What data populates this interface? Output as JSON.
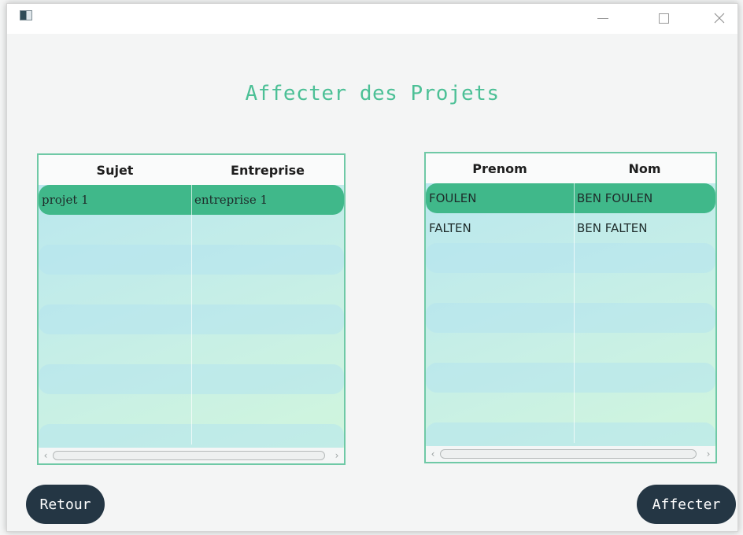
{
  "window": {
    "title": "",
    "controls": {
      "minimize": "minimize-icon",
      "maximize": "maximize-icon",
      "close": "close-icon"
    }
  },
  "page": {
    "title": "Affecter des Projets"
  },
  "projects_table": {
    "columns": [
      "Sujet",
      "Entreprise"
    ],
    "rows": [
      {
        "sujet": "projet 1",
        "entreprise": "entreprise 1",
        "selected": true
      }
    ]
  },
  "students_table": {
    "columns": [
      "Prenom",
      "Nom"
    ],
    "rows": [
      {
        "prenom": "FOULEN",
        "nom": "BEN FOULEN",
        "selected": true
      },
      {
        "prenom": "FALTEN",
        "nom": "BEN FALTEN",
        "selected": false
      }
    ]
  },
  "buttons": {
    "back": "Retour",
    "assign": "Affecter"
  },
  "colors": {
    "accent": "#4cc096",
    "selected_row": "#40b88a",
    "button_bg": "#243644",
    "table_border": "#6fc9a6"
  }
}
